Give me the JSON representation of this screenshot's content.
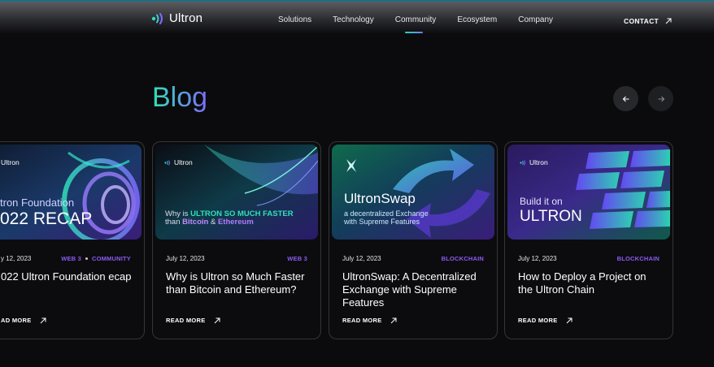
{
  "header": {
    "logo_text": "Ultron",
    "nav_items": [
      "Solutions",
      "Technology",
      "Community",
      "Ecosystem",
      "Company"
    ],
    "active_nav": "Community",
    "contact_label": "CONTACT"
  },
  "blog": {
    "title": "Blog",
    "prev_icon": "arrow-left-icon",
    "next_icon": "arrow-right-icon"
  },
  "cards": [
    {
      "thumb_logo": "Ultron",
      "thumb_line1": "tron Foundation",
      "thumb_line2": "022 RECAP",
      "date": "y 12, 2023",
      "tags": [
        "WEB 3",
        "COMMUNITY"
      ],
      "title": "022 Ultron Foundation ecap",
      "read_more": "AD MORE"
    },
    {
      "thumb_logo": "Ultron",
      "thumb_line1_a": "Why is ",
      "thumb_line1_b": "ULTRON SO MUCH FASTER",
      "thumb_line2_a": "than ",
      "thumb_line2_b": "Bitcoin",
      "thumb_line2_c": " & ",
      "thumb_line2_d": "Ethereum",
      "date": "July 12, 2023",
      "tags": [
        "WEB 3"
      ],
      "title": "Why is Ultron so Much Faster than Bitcoin and Ethereum?",
      "read_more": "READ MORE"
    },
    {
      "thumb_title": "UltronSwap",
      "thumb_sub1": "a decentralized Exchange",
      "thumb_sub2": "with Supreme Features",
      "date": "July 12, 2023",
      "tags": [
        "BLOCKCHAIN"
      ],
      "title": "UltronSwap: A Decentralized Exchange with Supreme Features",
      "read_more": "READ MORE"
    },
    {
      "thumb_logo": "Ultron",
      "thumb_line1": "Build it on",
      "thumb_line2": "ULTRON",
      "date": "July 12, 2023",
      "tags": [
        "BLOCKCHAIN"
      ],
      "title": "How to Deploy a Project on the Ultron Chain",
      "read_more": "READ MORE"
    }
  ],
  "colors": {
    "accent_teal": "#2fe0b8",
    "accent_purple": "#7d6cff",
    "tag_purple": "#8a5cf0",
    "background": "#0b0b0d"
  }
}
